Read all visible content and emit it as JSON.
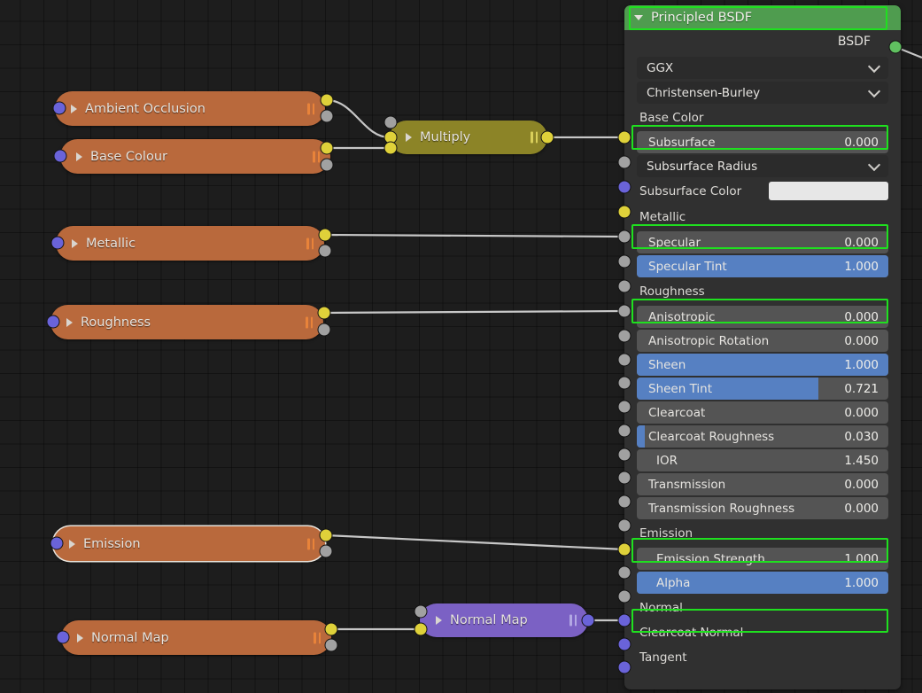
{
  "editor": {
    "background_color": "#1d1d1d",
    "grid_color": "#121212"
  },
  "nodes": [
    {
      "id": "ambient_occlusion",
      "label": "Ambient Occlusion",
      "color": "#b9693c",
      "type": "collapsed",
      "selected": false
    },
    {
      "id": "base_colour",
      "label": "Base Colour",
      "color": "#b9693c",
      "type": "collapsed",
      "selected": false
    },
    {
      "id": "metallic_node",
      "label": "Metallic",
      "color": "#b9693c",
      "type": "collapsed",
      "selected": false
    },
    {
      "id": "roughness_node",
      "label": "Roughness",
      "color": "#b9693c",
      "type": "collapsed",
      "selected": false
    },
    {
      "id": "emission_node",
      "label": "Emission",
      "color": "#b9693c",
      "type": "collapsed",
      "selected": true
    },
    {
      "id": "normal_map_node",
      "label": "Normal Map",
      "color": "#b9693c",
      "type": "collapsed",
      "selected": false
    },
    {
      "id": "multiply_node",
      "label": "Multiply",
      "color": "#8c8427",
      "type": "collapsed",
      "selected": false
    },
    {
      "id": "normal_map_shader",
      "label": "Normal Map",
      "color": "#7b61c4",
      "type": "collapsed",
      "selected": false
    }
  ],
  "bsdf": {
    "title": "Principled BSDF",
    "header_color": "#4f9c4f",
    "output": {
      "label": "BSDF",
      "socket_color": "#60c060"
    },
    "dropdowns": [
      {
        "name": "distribution",
        "value": "GGX"
      },
      {
        "name": "subsurface_method",
        "value": "Christensen-Burley"
      }
    ],
    "subsurface_color": {
      "label": "Subsurface Color",
      "swatch": "#e7e7e7"
    },
    "inputs": [
      {
        "label": "Base Color",
        "value": "",
        "fill": 0,
        "widget": "linked",
        "socket": "yellow",
        "highlighted": true
      },
      {
        "label": "Subsurface",
        "value": "0.000",
        "fill": 0,
        "widget": "slider",
        "socket": "gray",
        "highlighted": false
      },
      {
        "label": "Subsurface Radius",
        "value": "",
        "fill": 0,
        "widget": "dropdown",
        "socket": "purple",
        "highlighted": false
      },
      {
        "label": "Subsurface Color",
        "value": "",
        "fill": 0,
        "widget": "swatch",
        "socket": "yellow",
        "highlighted": false
      },
      {
        "label": "Metallic",
        "value": "",
        "fill": 0,
        "widget": "linked",
        "socket": "gray",
        "highlighted": true
      },
      {
        "label": "Specular",
        "value": "0.000",
        "fill": 0,
        "widget": "slider",
        "socket": "gray",
        "highlighted": false
      },
      {
        "label": "Specular Tint",
        "value": "1.000",
        "fill": 1.0,
        "widget": "slider",
        "socket": "gray",
        "highlighted": false
      },
      {
        "label": "Roughness",
        "value": "",
        "fill": 0,
        "widget": "linked",
        "socket": "gray",
        "highlighted": true
      },
      {
        "label": "Anisotropic",
        "value": "0.000",
        "fill": 0,
        "widget": "slider",
        "socket": "gray",
        "highlighted": false
      },
      {
        "label": "Anisotropic Rotation",
        "value": "0.000",
        "fill": 0,
        "widget": "slider",
        "socket": "gray",
        "highlighted": false
      },
      {
        "label": "Sheen",
        "value": "1.000",
        "fill": 1.0,
        "widget": "slider",
        "socket": "gray",
        "highlighted": false
      },
      {
        "label": "Sheen Tint",
        "value": "0.721",
        "fill": 0.721,
        "widget": "slider",
        "socket": "gray",
        "highlighted": false
      },
      {
        "label": "Clearcoat",
        "value": "0.000",
        "fill": 0,
        "widget": "slider",
        "socket": "gray",
        "highlighted": false
      },
      {
        "label": "Clearcoat Roughness",
        "value": "0.030",
        "fill": 0.03,
        "widget": "slider",
        "socket": "gray",
        "highlighted": false
      },
      {
        "label": "IOR",
        "value": "1.450",
        "fill": 0,
        "widget": "slider",
        "socket": "gray",
        "highlighted": false
      },
      {
        "label": "Transmission",
        "value": "0.000",
        "fill": 0,
        "widget": "slider",
        "socket": "gray",
        "highlighted": false
      },
      {
        "label": "Transmission Roughness",
        "value": "0.000",
        "fill": 0,
        "widget": "slider",
        "socket": "gray",
        "highlighted": false
      },
      {
        "label": "Emission",
        "value": "",
        "fill": 0,
        "widget": "linked",
        "socket": "yellow",
        "highlighted": true
      },
      {
        "label": "Emission Strength",
        "value": "1.000",
        "fill": 0,
        "widget": "slider",
        "socket": "gray",
        "highlighted": false
      },
      {
        "label": "Alpha",
        "value": "1.000",
        "fill": 1.0,
        "widget": "slider",
        "socket": "gray",
        "highlighted": false
      },
      {
        "label": "Normal",
        "value": "",
        "fill": 0,
        "widget": "linked",
        "socket": "purple",
        "highlighted": true
      },
      {
        "label": "Clearcoat Normal",
        "value": "",
        "fill": 0,
        "widget": "plain",
        "socket": "purple",
        "highlighted": false
      },
      {
        "label": "Tangent",
        "value": "",
        "fill": 0,
        "widget": "plain",
        "socket": "purple",
        "highlighted": false
      }
    ]
  },
  "socket_colors": {
    "yellow": "#dfd13a",
    "gray": "#a1a1a1",
    "purple": "#6a63d9",
    "green": "#60c060"
  },
  "annotation": {
    "highlight_color": "#1fe01f",
    "count": 7
  }
}
